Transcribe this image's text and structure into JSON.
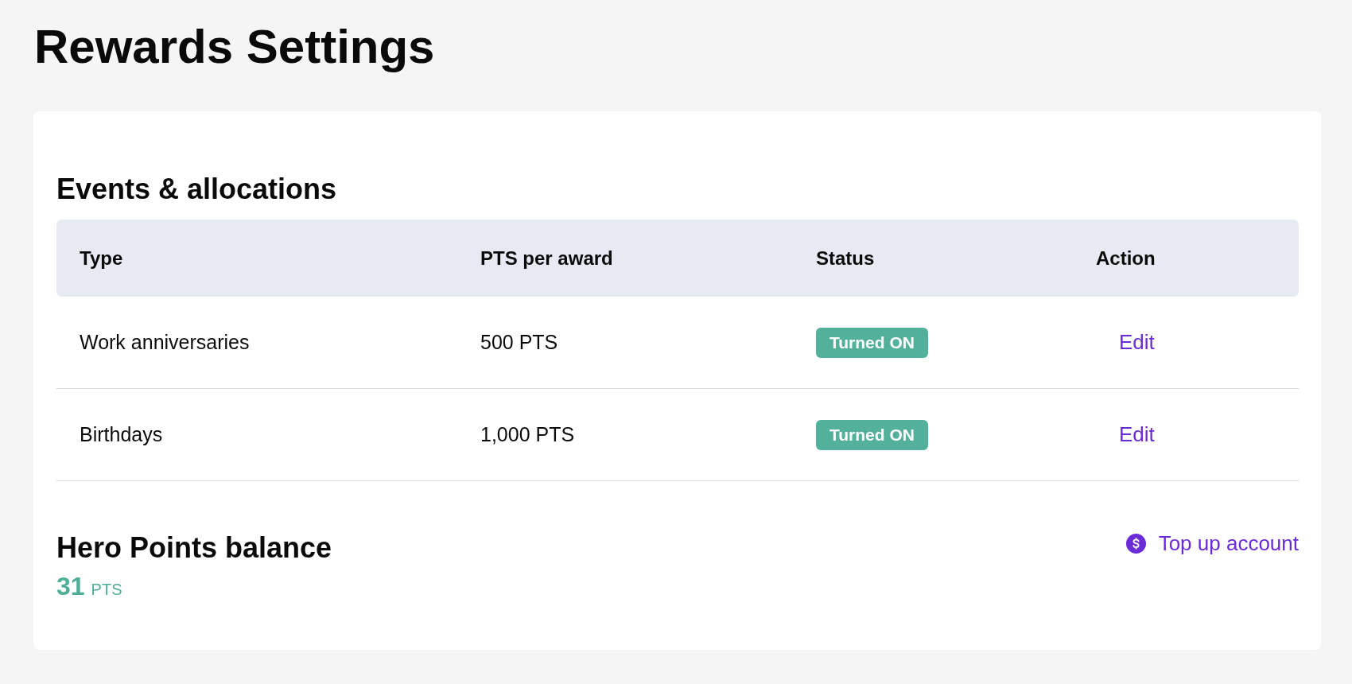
{
  "page": {
    "title": "Rewards Settings"
  },
  "events": {
    "heading": "Events & allocations",
    "columns": [
      "Type",
      "PTS per award",
      "Status",
      "Action"
    ],
    "rows": [
      {
        "type": "Work anniversaries",
        "points": "500 PTS",
        "status": {
          "label": "Turned ON",
          "on": true
        },
        "action": "Edit"
      },
      {
        "type": "Birthdays",
        "points": "1,000 PTS",
        "status": {
          "label": "Turned ON",
          "on": true
        },
        "action": "Edit"
      }
    ]
  },
  "balance": {
    "heading": "Hero Points balance",
    "amount": "31",
    "unit": "PTS",
    "top_up": "Top up account"
  }
}
